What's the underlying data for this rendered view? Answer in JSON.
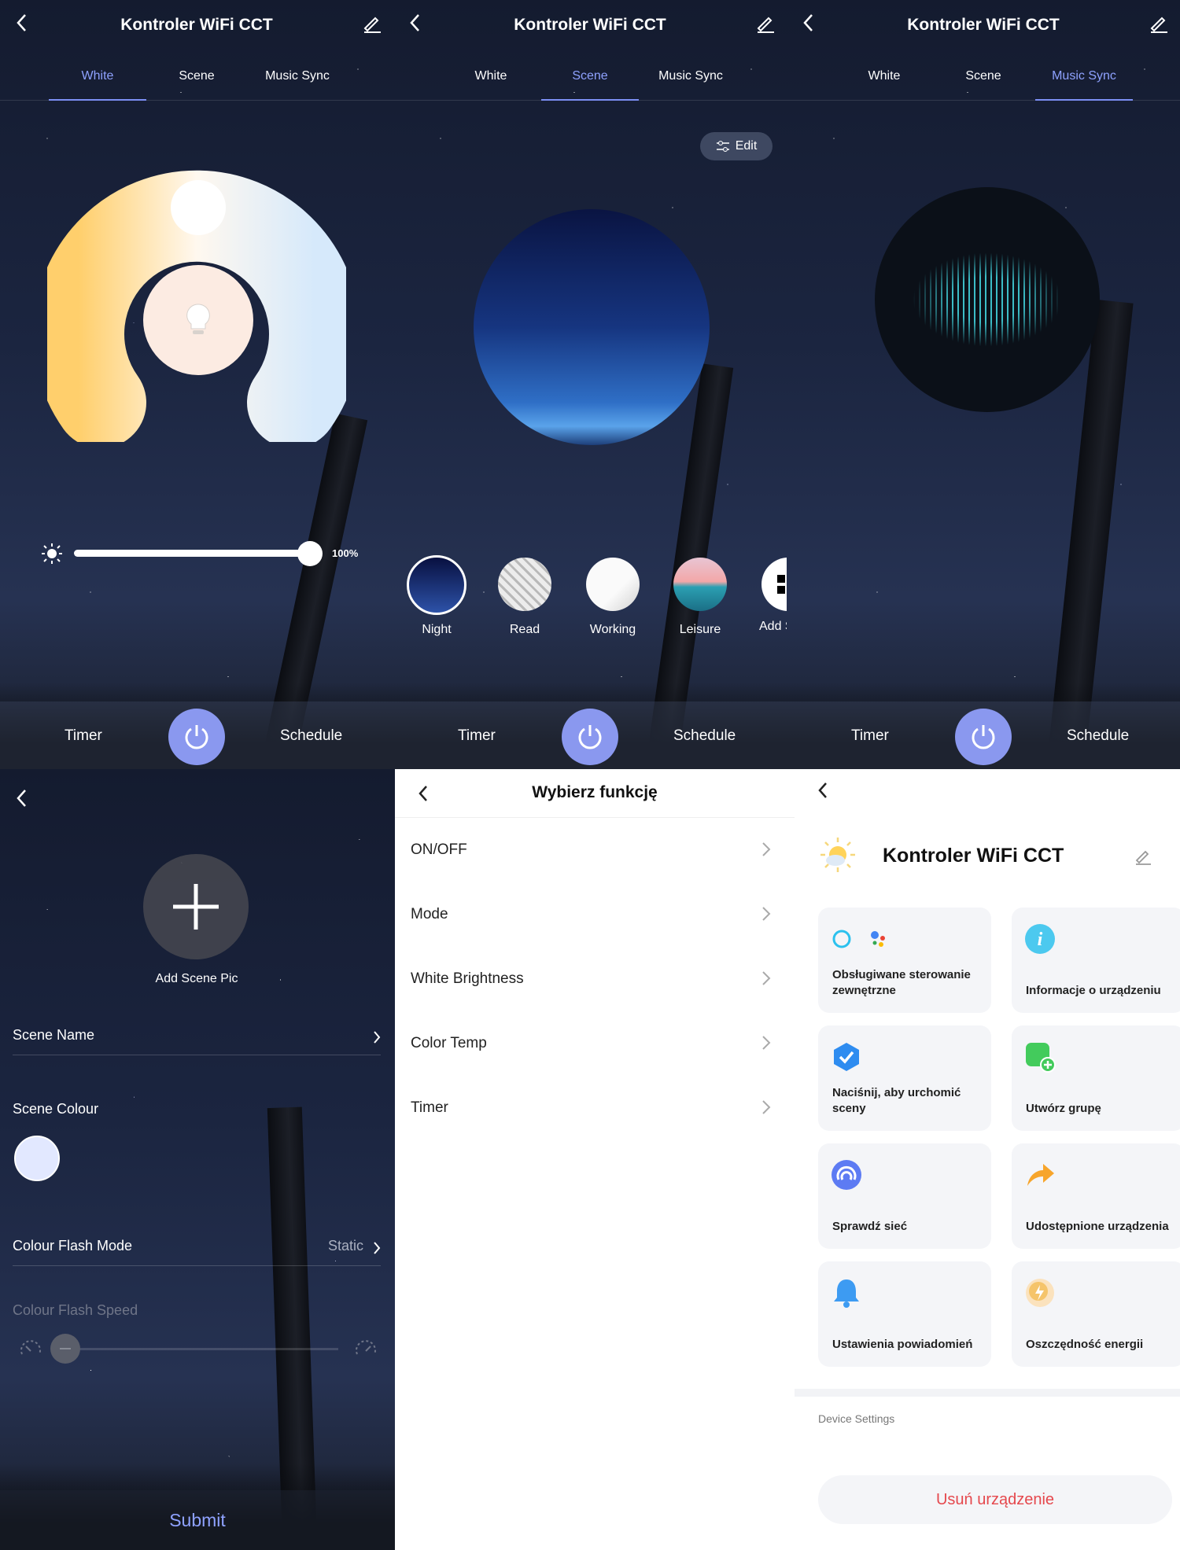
{
  "device_title": "Kontroler WiFi CCT",
  "tabs": [
    "White",
    "Scene",
    "Music Sync"
  ],
  "bottom": {
    "timer": "Timer",
    "schedule": "Schedule"
  },
  "white": {
    "brightness": "100%",
    "brightness_value": 1.0
  },
  "scene": {
    "edit": "Edit",
    "items": [
      {
        "name": "Night"
      },
      {
        "name": "Read"
      },
      {
        "name": "Working"
      },
      {
        "name": "Leisure"
      },
      {
        "name": "Add S"
      }
    ]
  },
  "add_scene": {
    "pic_label": "Add Scene Pic",
    "name_label": "Scene Name",
    "colour_label": "Scene Colour",
    "flash_mode_label": "Colour Flash Mode",
    "flash_mode_value": "Static",
    "flash_speed_label": "Colour Flash Speed",
    "submit": "Submit"
  },
  "functions": {
    "title": "Wybierz funkcję",
    "items": [
      "ON/OFF",
      "Mode",
      "White Brightness",
      "Color Temp",
      "Timer"
    ]
  },
  "settings": {
    "title": "Kontroler WiFi CCT",
    "cards": [
      "Obsługiwane sterowanie zewnętrzne",
      "Informacje o urządzeniu",
      "Naciśnij, aby urchomić sceny",
      "Utwórz grupę",
      "Sprawdź sieć",
      "Udostępnione urządzenia",
      "Ustawienia powiadomień",
      "Oszczędność energii"
    ],
    "section": "Device Settings",
    "remove": "Usuń urządzenie"
  },
  "colors": {
    "accent": "#8fa2ff",
    "power": "#8a98ef",
    "danger": "#e5484d"
  }
}
